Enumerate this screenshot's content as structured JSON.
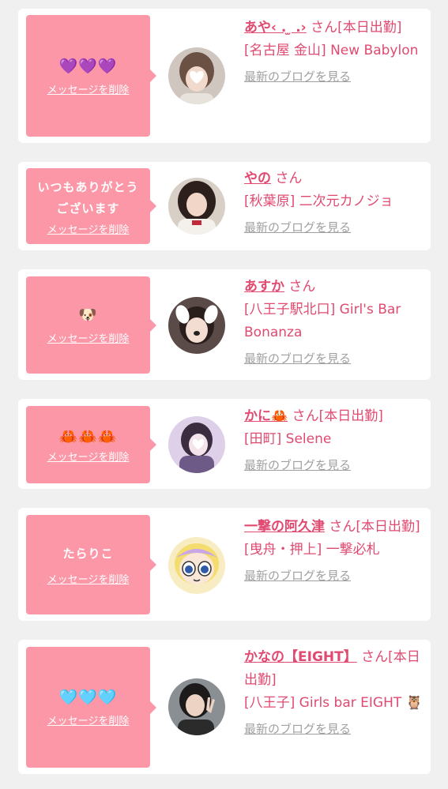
{
  "delete_label": "メッセージを削除",
  "blog_label": "最新のブログを見る",
  "san": "さん",
  "cards": [
    {
      "message": "💜💜💜",
      "name": "あや‹ . ̫ .›",
      "status": "[本日出勤]",
      "shop": "[名古屋 金山] New Babylon"
    },
    {
      "message": "いつもありがとうございます",
      "name": "やの",
      "status": "",
      "shop": "[秋葉原] 二次元カノジョ"
    },
    {
      "message": "🐶",
      "name": "あすか",
      "status": "",
      "shop": "[八王子駅北口] Girl's Bar Bonanza"
    },
    {
      "message": "🦀🦀🦀",
      "name": "かに🦀",
      "status": "[本日出勤]",
      "shop": "[田町] Selene"
    },
    {
      "message": "たらりこ",
      "name": "一撃の阿久津",
      "status": "[本日出勤]",
      "shop": "[曳舟・押上] 一撃必札"
    },
    {
      "message": "🩵🩵🩵",
      "name": "かなの【EIGHT】",
      "status": "[本日出勤]",
      "shop": "[八王子] Girls bar EIGHT 🦉"
    }
  ]
}
